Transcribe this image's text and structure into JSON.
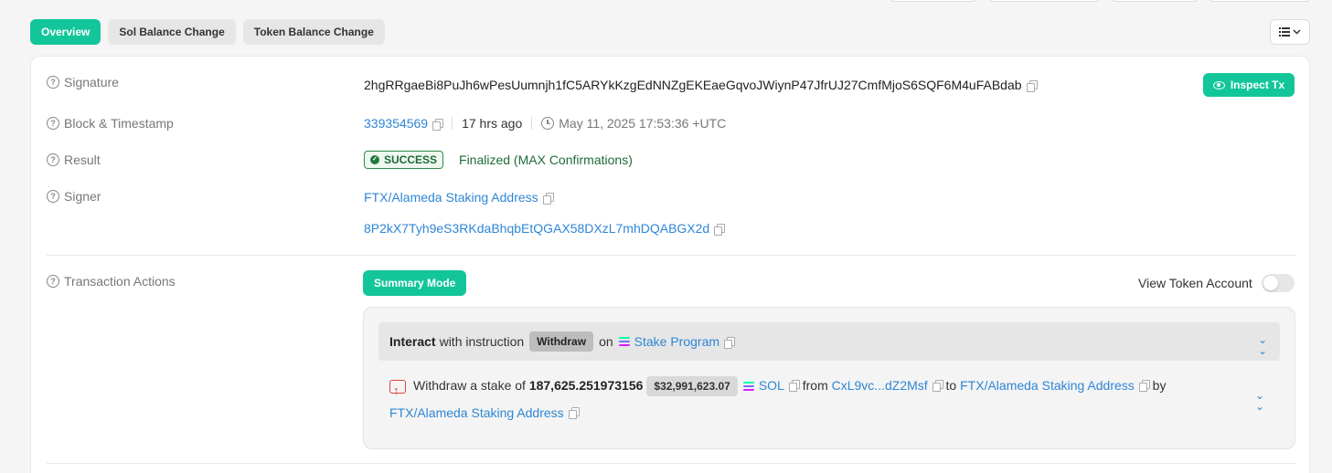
{
  "tabs": [
    {
      "label": "Overview",
      "active": true
    },
    {
      "label": "Sol Balance Change",
      "active": false
    },
    {
      "label": "Token Balance Change",
      "active": false
    }
  ],
  "overview": {
    "signature": {
      "label": "Signature",
      "value": "2hgRRgaeBi8PuJh6wPesUumnjh1fC5ARYkKzgEdNNZgEKEaeGqvoJWiynP47JfrUJ27CmfMjoS6SQF6M4uFABdab"
    },
    "inspect_button": "Inspect Tx",
    "block": {
      "label": "Block & Timestamp",
      "number": "339354569",
      "age": "17 hrs ago",
      "timestamp": "May 11, 2025 17:53:36 +UTC"
    },
    "result": {
      "label": "Result",
      "status": "SUCCESS",
      "confirmation": "Finalized (MAX Confirmations)"
    },
    "signer": {
      "label": "Signer",
      "name": "FTX/Alameda Staking Address",
      "address": "8P2kX7Tyh9eS3RKdaBhqbEtQGAX58DXzL7mhDQABGX2d"
    }
  },
  "actions": {
    "label": "Transaction Actions",
    "summary_button": "Summary Mode",
    "view_token_account": "View Token Account",
    "view_token_account_on": false,
    "interact": {
      "prefix": "Interact",
      "middle": "with instruction",
      "instruction": "Withdraw",
      "on": "on",
      "program": "Stake Program"
    },
    "withdraw": {
      "text_prefix": "Withdraw a stake of",
      "amount": "187,625.251973156",
      "usd": "$32,991,623.07",
      "token": "SOL",
      "from_label": "from",
      "from": "CxL9vc...dZ2Msf",
      "to_label": "to",
      "to": "FTX/Alameda Staking Address",
      "by_label": "by",
      "by": "FTX/Alameda Staking Address"
    }
  },
  "icons": {
    "help": "question-circle-icon",
    "copy": "copy-icon",
    "clock": "clock-icon",
    "eye": "eye-icon",
    "list": "list-icon",
    "chevron": "double-chevron-down-icon"
  },
  "colors": {
    "accent": "#13c69a",
    "link": "#2f86d6",
    "success": "#1f6b36",
    "withdraw_icon": "#e0443e"
  }
}
